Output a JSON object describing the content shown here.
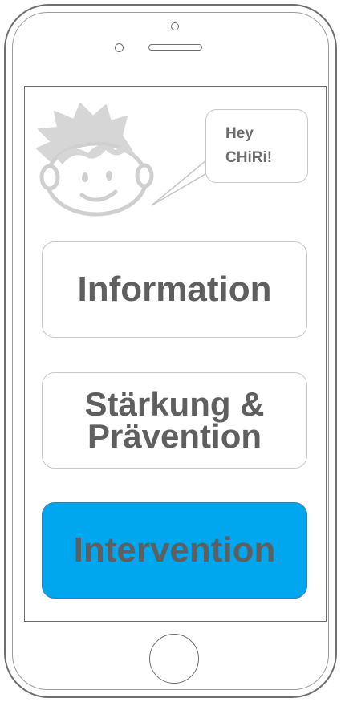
{
  "mascot": {
    "icon": "boy-face-icon",
    "speech": [
      "Hey",
      "CHiRi!"
    ]
  },
  "menu": [
    {
      "id": "information",
      "lines": [
        "Information"
      ],
      "highlighted": false
    },
    {
      "id": "staerkung",
      "lines": [
        "Stärkung &",
        "Prävention"
      ],
      "highlighted": false
    },
    {
      "id": "intervention",
      "lines": [
        "Intervention"
      ],
      "highlighted": true
    }
  ],
  "colors": {
    "accent": "#00a6ee",
    "button_text": "#5f5f5f",
    "frame": "#6f6f6f"
  }
}
